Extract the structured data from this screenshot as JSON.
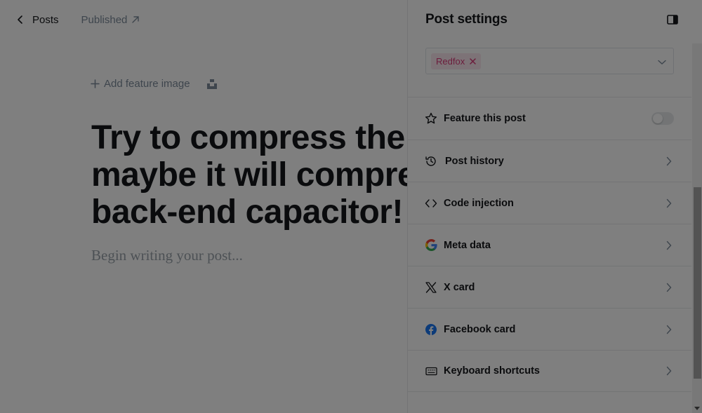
{
  "topbar": {
    "back_label": "Posts",
    "status_label": "Published"
  },
  "editor": {
    "add_feature_image": "Add feature image",
    "title": "Try to compress the microchip, maybe it will compress the back-end capacitor!",
    "body_placeholder": "Begin writing your post..."
  },
  "settings": {
    "title": "Post settings",
    "tags": [
      "Redfox"
    ],
    "rows": {
      "feature": "Feature this post",
      "history": "Post history",
      "code": "Code injection",
      "meta": "Meta data",
      "x": "X card",
      "facebook": "Facebook card",
      "keyboard": "Keyboard shortcuts"
    },
    "feature_enabled": false
  },
  "colors": {
    "tag_bg": "#fbe7ef",
    "tag_text": "#d83a79",
    "facebook": "#1877f2",
    "overlay": "rgba(0,0,0,0.5)"
  }
}
